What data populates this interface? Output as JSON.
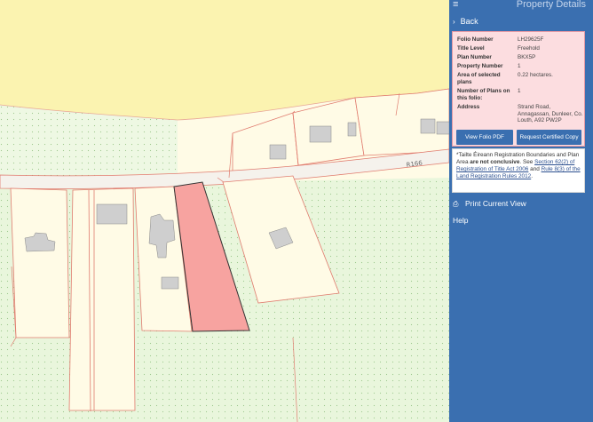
{
  "panel": {
    "title": "Property Details",
    "back_label": "Back",
    "details": [
      {
        "key": "Folio Number",
        "value": "LH29625F"
      },
      {
        "key": "Title Level",
        "value": "Freehold"
      },
      {
        "key": "Plan Number",
        "value": "BKX5P"
      },
      {
        "key": "Property Number",
        "value": "1"
      },
      {
        "key": "Area of selected plans",
        "value": "0.22 hectares."
      },
      {
        "key": "Number of Plans on this folio:",
        "value": "1"
      },
      {
        "key": "Address",
        "value": "Strand Road, Annagassan, Dunleer, Co. Louth, A92 PW2P"
      }
    ],
    "view_folio_label": "View Folio PDF",
    "request_copy_label": "Request Certified Copy",
    "notice": {
      "prefix": "*Tailte Éireann Registration Boundaries and Plan Area ",
      "bold": "are not conclusive",
      "middle": ". See ",
      "link1": "Section 62(2) of Registration of Title Act 2006",
      "and": " and ",
      "link2": "Rule 8(3) of the Land Registration Rules 2012",
      "end": "."
    },
    "print_label": "Print Current View",
    "help_label": "Help"
  },
  "map": {
    "road_label": "R166",
    "colors": {
      "shore": "#fbf3b0",
      "parcel_fill": "#fffbe6",
      "green": "#e9f6dc",
      "boundary": "#e07b6e",
      "selected_fill": "#f7a3a0",
      "building": "#cfcfcf"
    }
  }
}
